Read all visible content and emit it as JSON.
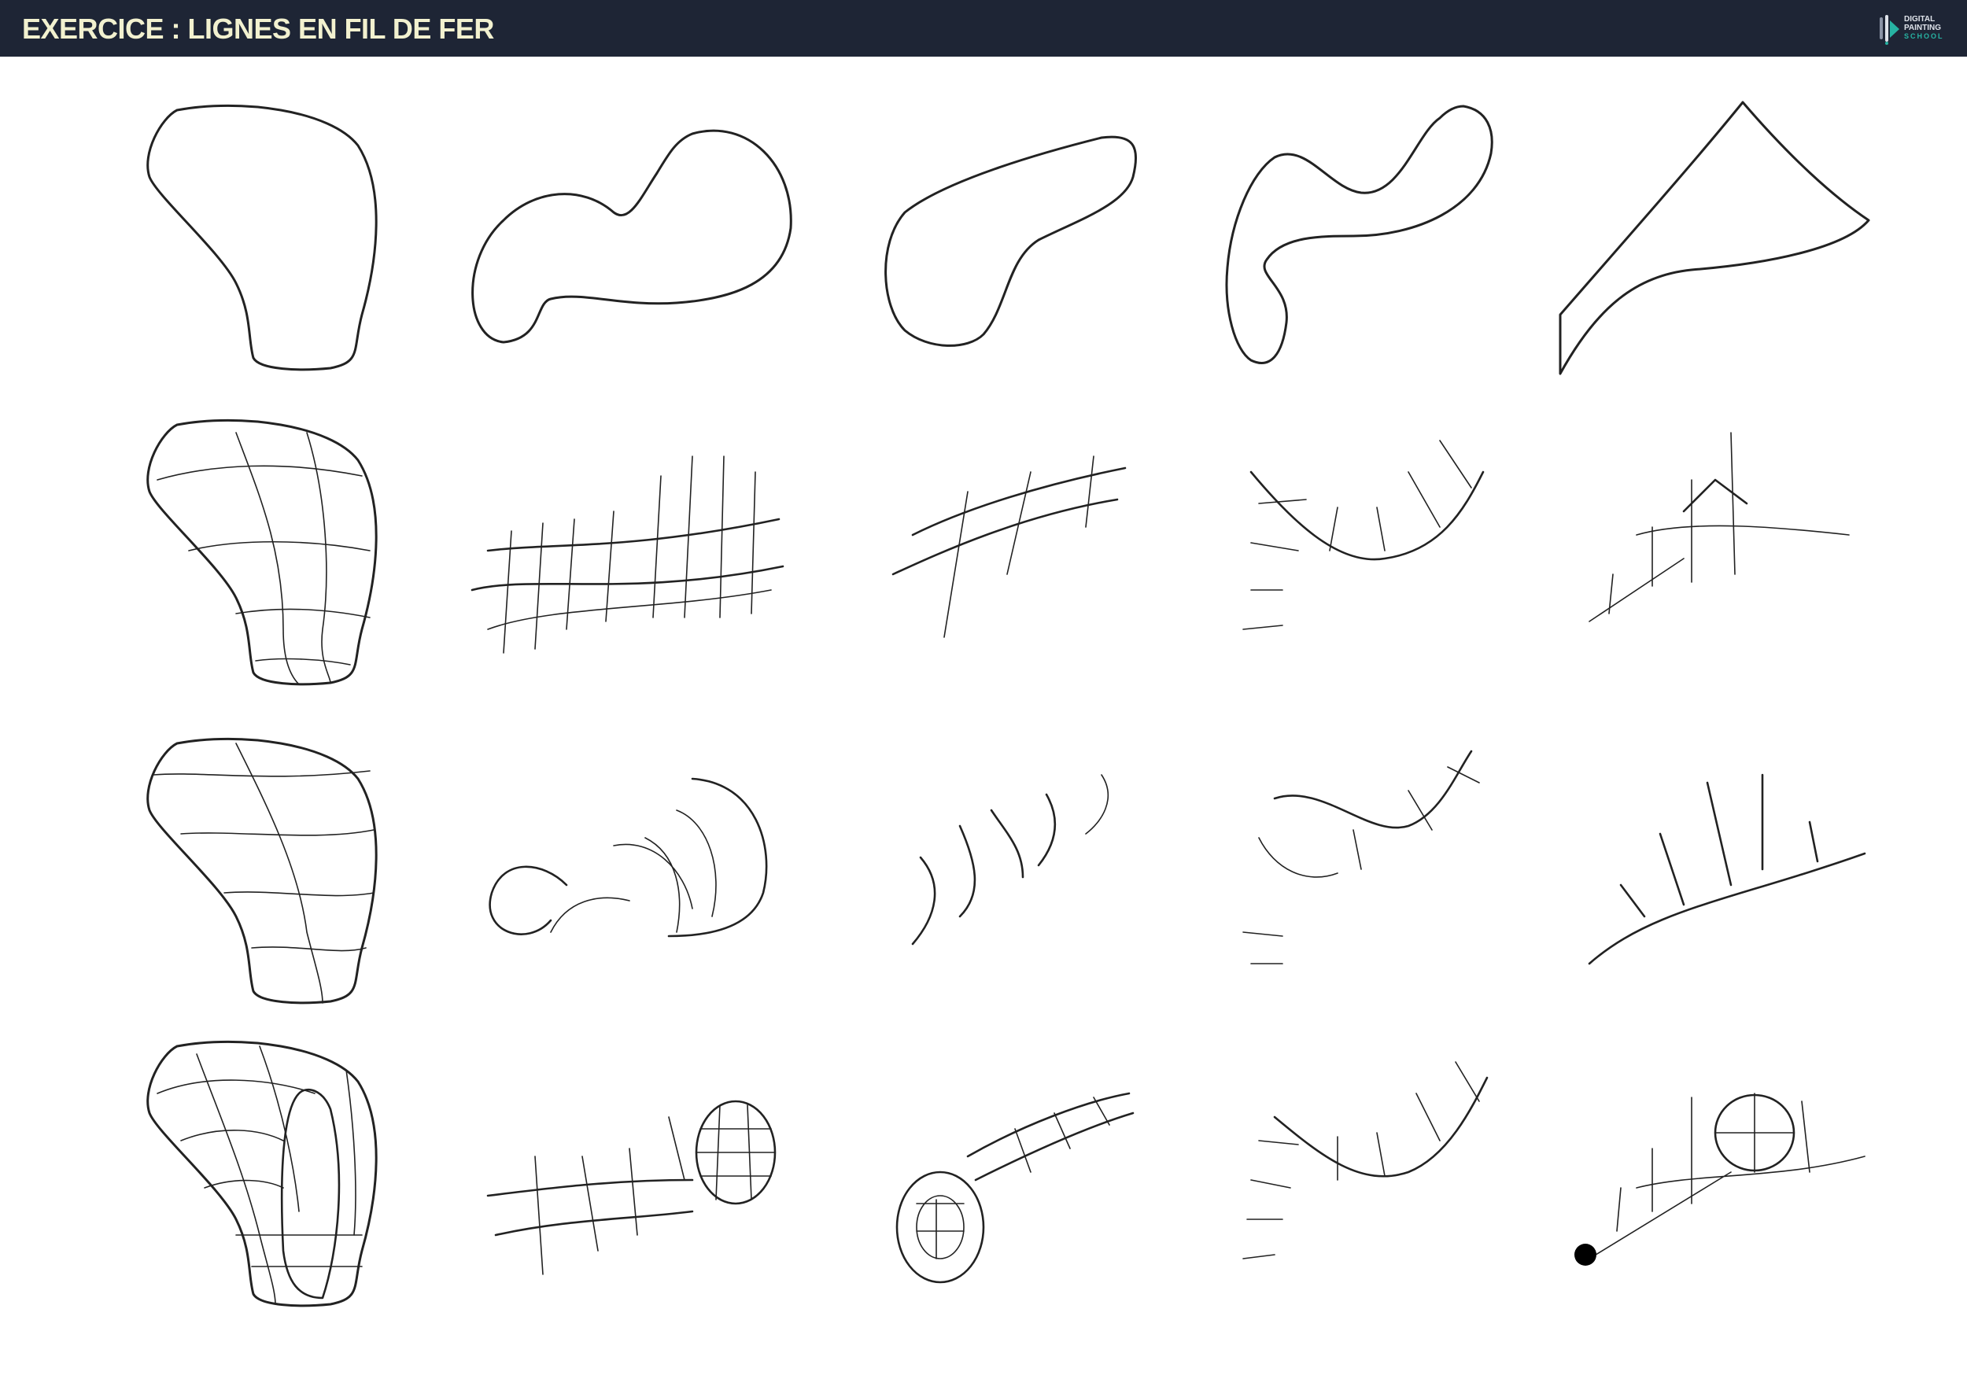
{
  "header": {
    "title": "EXERCICE : LIGNES EN FIL DE FER",
    "logo": {
      "line1": "DIGITAL",
      "line2": "PAINTING",
      "line3": "SCHOOL",
      "icon": "brush-logo-icon",
      "accent_color": "#27b3a3"
    },
    "background_color": "#1e2535",
    "title_color": "#f2f1cf"
  },
  "grid": {
    "rows": 4,
    "columns": 5
  }
}
